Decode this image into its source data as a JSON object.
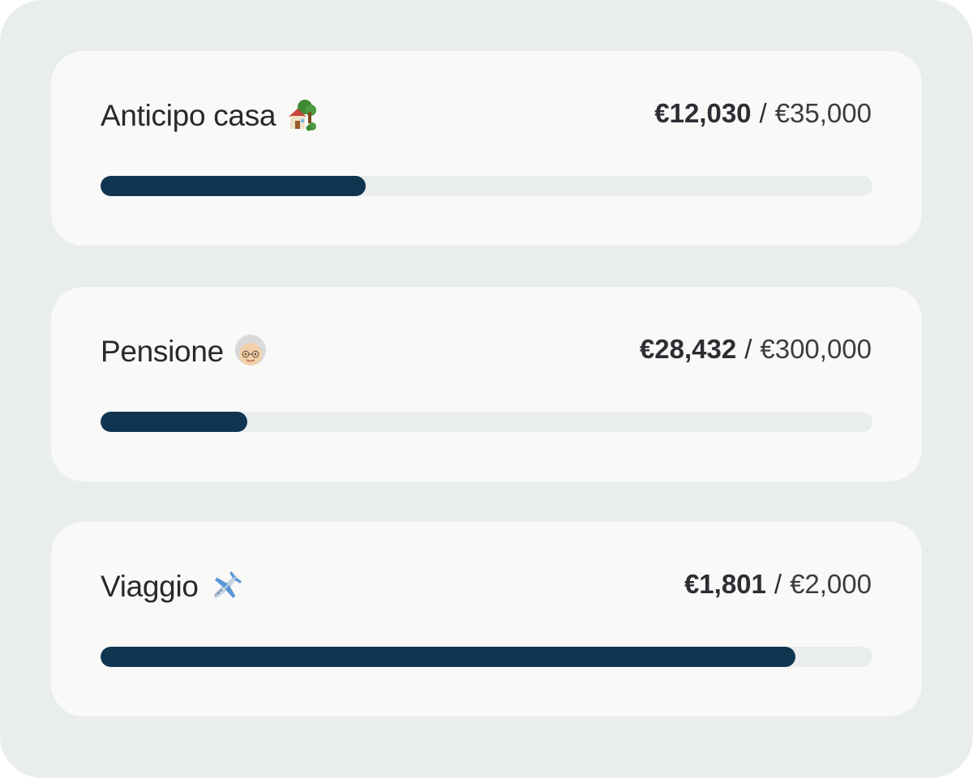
{
  "goals": [
    {
      "title": "Anticipo casa",
      "emoji": "house-with-garden-icon",
      "current": "€12,030",
      "separator": "/",
      "target": "€35,000",
      "progress": 0.3437
    },
    {
      "title": "Pensione",
      "emoji": "older-woman-icon",
      "current": "€28,432",
      "separator": "/",
      "target": "€300,000",
      "progress": 0.19
    },
    {
      "title": "Viaggio",
      "emoji": "airplane-icon",
      "current": "€1,801",
      "separator": "/",
      "target": "€2,000",
      "progress": 0.9005
    }
  ],
  "colors": {
    "background": "#e9edee",
    "card": "#f9f9f8",
    "progress_fill": "#0f3550",
    "progress_track": "#e9edee",
    "text": "#27292d"
  }
}
